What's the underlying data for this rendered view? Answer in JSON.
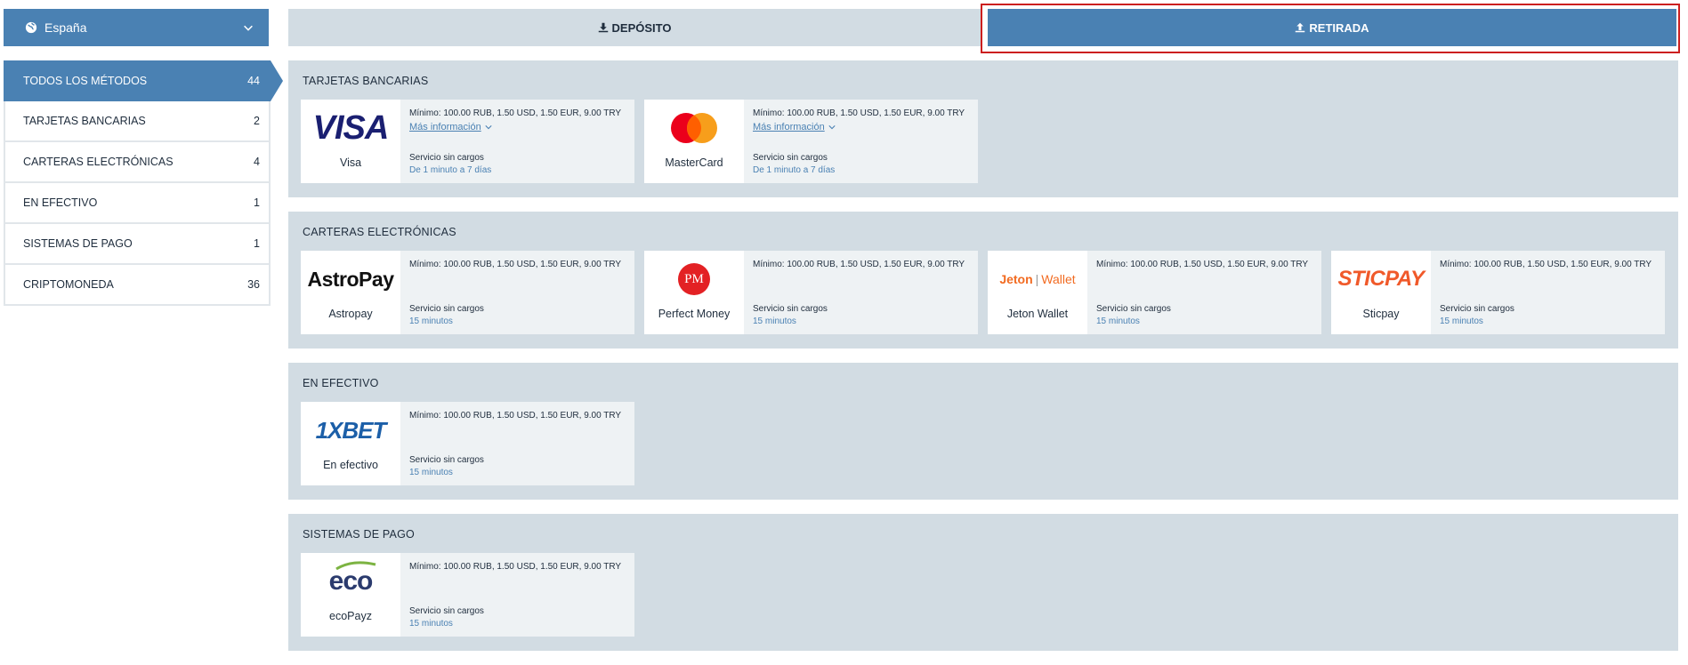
{
  "country": {
    "label": "España"
  },
  "tabs": {
    "deposit": "DEPÓSITO",
    "withdraw": "RETIRADA"
  },
  "sidebar": {
    "items": [
      {
        "label": "TODOS LOS MÉTODOS",
        "count": "44"
      },
      {
        "label": "TARJETAS BANCARIAS",
        "count": "2"
      },
      {
        "label": "CARTERAS ELECTRÓNICAS",
        "count": "4"
      },
      {
        "label": "EN EFECTIVO",
        "count": "1"
      },
      {
        "label": "SISTEMAS DE PAGO",
        "count": "1"
      },
      {
        "label": "CRIPTOMONEDA",
        "count": "36"
      }
    ]
  },
  "sections": {
    "bank_cards": {
      "title": "TARJETAS BANCARIAS",
      "cards": [
        {
          "name": "Visa",
          "logo_text": "VISA",
          "min": "Mínimo: 100.00 RUB, 1.50 USD, 1.50 EUR, 9.00 TRY",
          "more": "Más información",
          "fee": "Servicio sin cargos",
          "time": "De 1 minuto a 7 días"
        },
        {
          "name": "MasterCard",
          "min": "Mínimo: 100.00 RUB, 1.50 USD, 1.50 EUR, 9.00 TRY",
          "more": "Más información",
          "fee": "Servicio sin cargos",
          "time": "De 1 minuto a 7 días"
        }
      ]
    },
    "ewallets": {
      "title": "CARTERAS ELECTRÓNICAS",
      "cards": [
        {
          "name": "Astropay",
          "logo_text": "AstroPay",
          "min": "Mínimo: 100.00 RUB, 1.50 USD, 1.50 EUR, 9.00 TRY",
          "fee": "Servicio sin cargos",
          "time": "15 minutos"
        },
        {
          "name": "Perfect Money",
          "logo_text": "PM",
          "min": "Mínimo: 100.00 RUB, 1.50 USD, 1.50 EUR, 9.00 TRY",
          "fee": "Servicio sin cargos",
          "time": "15 minutos"
        },
        {
          "name": "Jeton Wallet",
          "logo_text_a": "Jeton",
          "logo_text_b": "Wallet",
          "min": "Mínimo: 100.00 RUB, 1.50 USD, 1.50 EUR, 9.00 TRY",
          "fee": "Servicio sin cargos",
          "time": "15 minutos"
        },
        {
          "name": "Sticpay",
          "logo_text": "STICPAY",
          "min": "Mínimo: 100.00 RUB, 1.50 USD, 1.50 EUR, 9.00 TRY",
          "fee": "Servicio sin cargos",
          "time": "15 minutos"
        }
      ]
    },
    "cash": {
      "title": "EN EFECTIVO",
      "cards": [
        {
          "name": "En efectivo",
          "logo_text": "1XBET",
          "min": "Mínimo: 100.00 RUB, 1.50 USD, 1.50 EUR, 9.00 TRY",
          "fee": "Servicio sin cargos",
          "time": "15 minutos"
        }
      ]
    },
    "payment_systems": {
      "title": "SISTEMAS DE PAGO",
      "cards": [
        {
          "name": "ecoPayz",
          "logo_text": "eco",
          "min": "Mínimo: 100.00 RUB, 1.50 USD, 1.50 EUR, 9.00 TRY",
          "fee": "Servicio sin cargos",
          "time": "15 minutos"
        }
      ]
    }
  },
  "colors": {
    "accent": "#4a81b3",
    "panel": "#d2dce3",
    "highlight": "#cc1f1f"
  }
}
